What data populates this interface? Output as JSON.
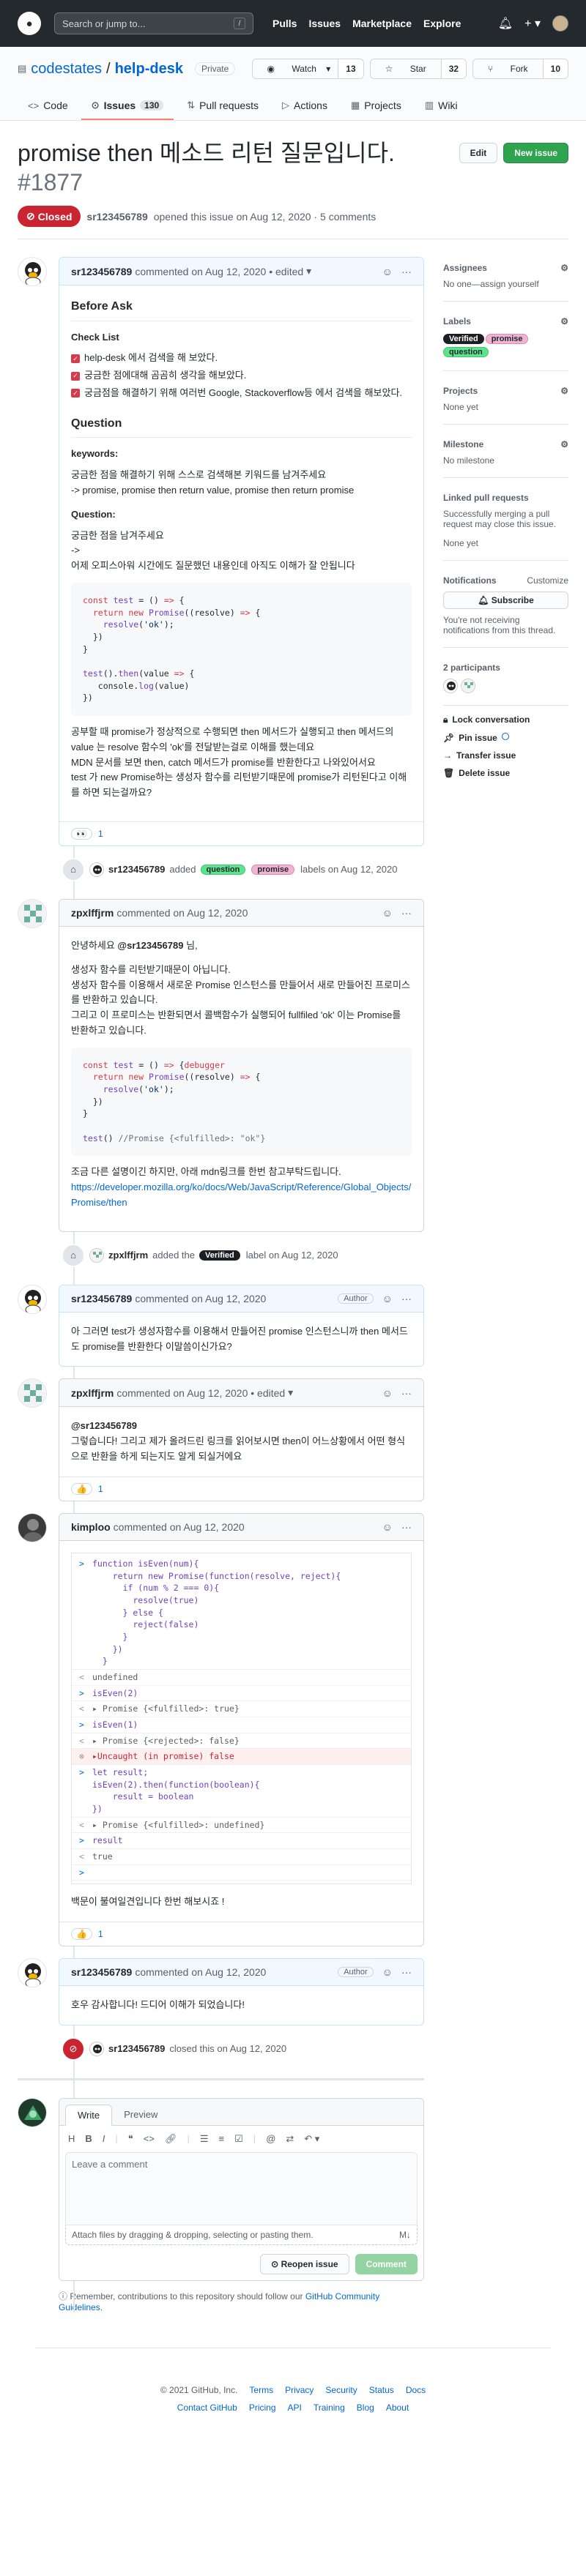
{
  "header": {
    "search_placeholder": "Search or jump to...",
    "slash": "/",
    "nav": [
      "Pulls",
      "Issues",
      "Marketplace",
      "Explore"
    ],
    "plus": "+"
  },
  "repo": {
    "owner": "codestates",
    "sep": "/",
    "name": "help-desk",
    "visibility": "Private",
    "watch_label": "Watch",
    "watch_count": "13",
    "star_label": "Star",
    "star_count": "32",
    "fork_label": "Fork",
    "fork_count": "10",
    "tabs": [
      {
        "label": "Code"
      },
      {
        "label": "Issues",
        "count": "130"
      },
      {
        "label": "Pull requests"
      },
      {
        "label": "Actions"
      },
      {
        "label": "Projects"
      },
      {
        "label": "Wiki"
      }
    ]
  },
  "issue": {
    "title": "promise then 메소드 리턴 질문입니다.",
    "number": "#1877",
    "edit_label": "Edit",
    "new_issue_label": "New issue",
    "status": "Closed",
    "author": "sr123456789",
    "opened_text": "opened this issue on Aug 12, 2020 · 5 comments"
  },
  "comments": {
    "c1": {
      "author": "sr123456789",
      "meta": "commented on Aug 12, 2020 • edited",
      "h_before": "Before Ask",
      "h_checklist": "Check List",
      "checks": [
        "help-desk 에서 검색을 해 보았다.",
        "궁금한 점에대해 곰곰히 생각을 해보았다.",
        "궁금점을 해결하기 위해 여러번 Google, Stackoverflow등 에서 검색을 해보았다."
      ],
      "h_question": "Question",
      "h_keywords": "keywords:",
      "kw_line1": "궁금한 점을 해결하기 위해 스스로 검색해본 키워드를 남겨주세요",
      "kw_line2": "-> promise, promise then return value, promise then return promise",
      "h_q2": "Question:",
      "q_line1": "궁금한 점을 남겨주세요",
      "q_line2": "->",
      "q_line3": "어제 오피스아워 시간에도 질문했던 내용인데 아직도 이해가 잘 안됩니다",
      "p_line1": "공부할 때 promise가 정상적으로 수행되면 then 메서드가 실행되고 then 메서드의",
      "p_line2": "value 는 resolve 함수의 'ok'를 전달받는걸로 이해를 했는데요",
      "p_line3": "MDN 문서를 보면 then, catch 메서드가 promise를 반환한다고 나와있어서요",
      "p_line4": "test 가 new Promise하는 생성자 함수를 리턴받기때문에 promise가 리턴된다고 이해",
      "p_line5": "를 하면 되는걸까요?",
      "reaction_icon": "👀",
      "reaction_count": "1"
    },
    "ev1": {
      "actor": "sr123456789",
      "added": "added",
      "labels": [
        "question",
        "promise"
      ],
      "suffix": "labels on Aug 12, 2020"
    },
    "c2": {
      "author": "zpxlffjrm",
      "meta": "commented on Aug 12, 2020",
      "greet_mention": "@sr123456789",
      "greet_pre": "안녕하세요 ",
      "greet_post": " 님,",
      "l1": "생성자 함수를 리턴받기때문이 아닙니다.",
      "l2": "생성자 함수를 이용해서 새로운 Promise 인스턴스를 만들어서 새로 만들어진 프로미스",
      "l3": "를 반환하고 있습니다.",
      "l4": "그리고 이 프로미스는 반환되면서 콜백함수가 실행되어 fullfiled 'ok' 이는 Promise를",
      "l5": "반환하고 있습니다.",
      "after": "조금 다른 설명이긴 하지만, 아래 mdn링크를 한번 참고부탁드립니다.",
      "link": "https://developer.mozilla.org/ko/docs/Web/JavaScript/Reference/Global_Objects/Promise/then"
    },
    "ev2": {
      "actor": "zpxlffjrm",
      "added": "added the",
      "label": "Verified",
      "suffix": "label on Aug 12, 2020"
    },
    "c3": {
      "author": "sr123456789",
      "meta": "commented on Aug 12, 2020",
      "badge": "Author",
      "l1": "아 그러면 test가 생성자함수를 이용해서 만들어진 promise 인스턴스니까 then 메서드",
      "l2": "도 promise를 반환한다 이말씀이신가요?"
    },
    "c4": {
      "author": "zpxlffjrm",
      "meta": "commented on Aug 12, 2020 • edited",
      "mention": "@sr123456789",
      "l1": "그렇습니다! 그리고 제가 올려드린 링크를 읽어보시면 then이 어느상황에서 어떤 형식",
      "l2": "으로 반환을 하게 되는지도 알게 되실거에요",
      "reaction_icon": "👍",
      "reaction_count": "1"
    },
    "c5": {
      "author": "kimploo",
      "meta": "commented on Aug 12, 2020",
      "after": "백문이 불여일견입니다 한번 해보시죠 !",
      "reaction_icon": "👍",
      "reaction_count": "1"
    },
    "c6": {
      "author": "sr123456789",
      "meta": "commented on Aug 12, 2020",
      "badge": "Author",
      "l1": "호우 감사합니다! 드디어 이해가 되었습니다!"
    },
    "ev3": {
      "actor": "sr123456789",
      "text": "closed this on Aug 12, 2020"
    }
  },
  "code1": [
    "const test = () => {",
    "  return new Promise((resolve) => {",
    "    resolve('ok');",
    "  })",
    "}",
    "",
    "test().then(value => {",
    "   console.log(value)",
    "})"
  ],
  "code2": [
    "const test = () => {debugger",
    "  return new Promise((resolve) => {",
    "    resolve('ok');",
    "  })",
    "}",
    "",
    "test() //Promise {<fulfilled>: \"ok\"}"
  ],
  "console": [
    {
      "k": "in",
      "t": "function isEven(num){\n    return new Promise(function(resolve, reject){\n      if (num % 2 === 0){\n        resolve(true)\n      } else {\n        reject(false)\n      }\n    })\n  }"
    },
    {
      "k": "out",
      "t": "undefined"
    },
    {
      "k": "in",
      "t": "isEven(2)"
    },
    {
      "k": "out",
      "t": "▸ Promise {<fulfilled>: true}"
    },
    {
      "k": "in",
      "t": "isEven(1)"
    },
    {
      "k": "out",
      "t": "▸ Promise {<rejected>: false}"
    },
    {
      "k": "err",
      "t": "▸Uncaught (in promise) false"
    },
    {
      "k": "in",
      "t": "let result;\nisEven(2).then(function(boolean){\n    result = boolean\n})"
    },
    {
      "k": "out",
      "t": "▸ Promise {<fulfilled>: undefined}"
    },
    {
      "k": "in",
      "t": "result"
    },
    {
      "k": "out",
      "t": "true"
    },
    {
      "k": "in",
      "t": ""
    }
  ],
  "sidebar": {
    "assignees_h": "Assignees",
    "assignees_v": "No one—assign yourself",
    "labels_h": "Labels",
    "labels": [
      "Verified",
      "promise",
      "question"
    ],
    "projects_h": "Projects",
    "projects_v": "None yet",
    "milestone_h": "Milestone",
    "milestone_v": "No milestone",
    "linked_h": "Linked pull requests",
    "linked_desc": "Successfully merging a pull request may close this issue.",
    "linked_v": "None yet",
    "notif_h": "Notifications",
    "customize": "Customize",
    "subscribe": "Subscribe",
    "notif_desc": "You're not receiving notifications from this thread.",
    "participants_h": "2 participants",
    "lock": "Lock conversation",
    "pin": "Pin issue",
    "transfer": "Transfer issue",
    "delete": "Delete issue"
  },
  "composer": {
    "tab_write": "Write",
    "tab_preview": "Preview",
    "placeholder": "Leave a comment",
    "attach": "Attach files by dragging & dropping, selecting or pasting them.",
    "reopen": "Reopen issue",
    "comment": "Comment",
    "remember_pre": "Remember, contributions to this repository should follow our ",
    "remember_link": "GitHub Community Guidelines",
    "remember_post": "."
  },
  "footer": {
    "copyright": "© 2021 GitHub, Inc.",
    "row1": [
      "Terms",
      "Privacy",
      "Security",
      "Status",
      "Docs"
    ],
    "row2": [
      "Contact GitHub",
      "Pricing",
      "API",
      "Training",
      "Blog",
      "About"
    ]
  }
}
